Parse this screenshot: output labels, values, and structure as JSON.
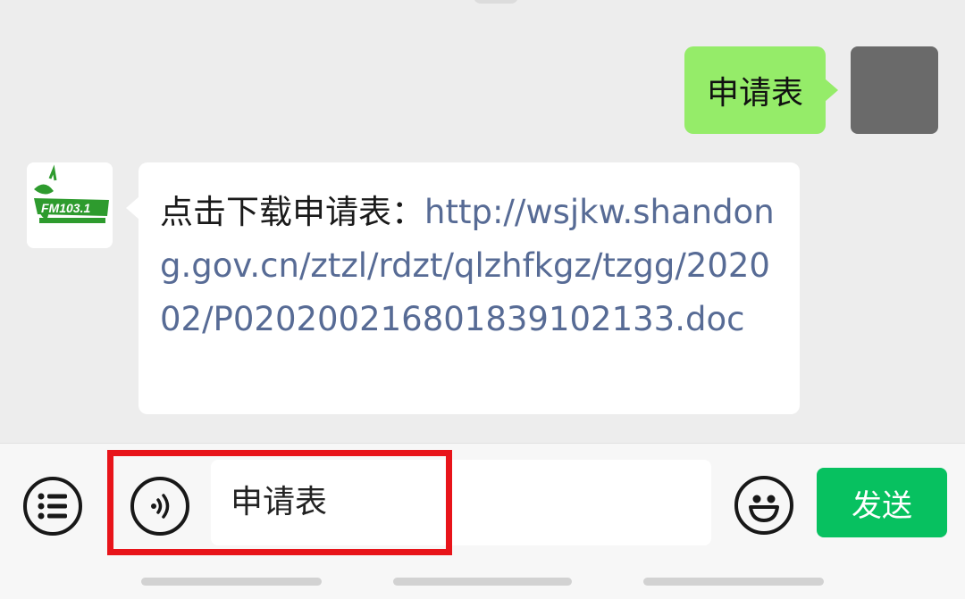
{
  "chat": {
    "sent_message": "申请表",
    "received_prefix": "点击下载申请表：",
    "received_link": "http://wsjkw.shandong.gov.cn/ztzl/rdzt/qlzhfkgz/tzgg/202002/P020200216801839102133.doc",
    "bot_avatar_text": "FM103.1"
  },
  "input_bar": {
    "menu_icon": "list-icon",
    "voice_icon": "voice-icon",
    "input_value": "申请表",
    "emoji_icon": "emoji-icon",
    "send_label": "发送"
  },
  "colors": {
    "chat_background": "#ededed",
    "sent_bubble": "#95ec69",
    "link": "#576b95",
    "send_button": "#07c160",
    "highlight_box": "#e8141a"
  }
}
